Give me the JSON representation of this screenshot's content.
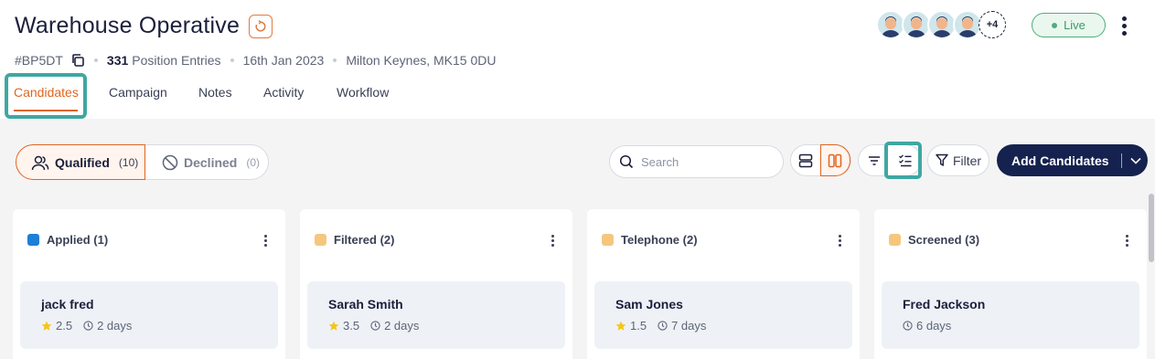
{
  "header": {
    "title": "Warehouse Operative",
    "job_id": "#BP5DT",
    "position_count": "331",
    "position_label": "Position Entries",
    "date": "16th Jan 2023",
    "location": "Milton Keynes, MK15 0DU",
    "avatar_more": "+4",
    "status": "Live"
  },
  "tabs": [
    "Candidates",
    "Campaign",
    "Notes",
    "Activity",
    "Workflow"
  ],
  "toolbar": {
    "qualified_label": "Qualified",
    "qualified_count": "(10)",
    "declined_label": "Declined",
    "declined_count": "(0)",
    "search_placeholder": "Search",
    "filter_label": "Filter",
    "add_label": "Add Candidates"
  },
  "columns": [
    {
      "title": "Applied (1)",
      "color": "#1e7fd6",
      "card": {
        "name": "jack fred",
        "rating": "2.5",
        "time": "2 days"
      }
    },
    {
      "title": "Filtered (2)",
      "color": "#f5c77e",
      "card": {
        "name": "Sarah Smith",
        "rating": "3.5",
        "time": "2 days"
      }
    },
    {
      "title": "Telephone (2)",
      "color": "#f5c77e",
      "card": {
        "name": "Sam Jones",
        "rating": "1.5",
        "time": "7 days"
      }
    },
    {
      "title": "Screened (3)",
      "color": "#f5c77e",
      "card": {
        "name": "Fred Jackson",
        "rating": "",
        "time": "6 days"
      }
    }
  ],
  "colors": {
    "accent": "#e0651f",
    "primary": "#15224f",
    "highlight": "#3fa7a2",
    "live": "#4caf7a"
  }
}
